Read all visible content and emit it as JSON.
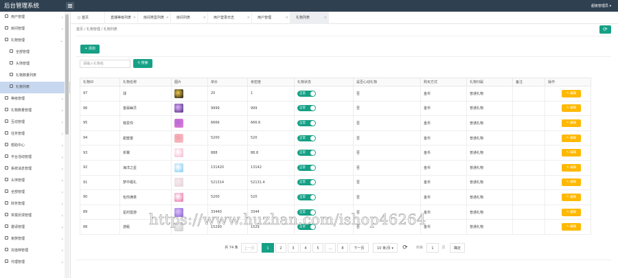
{
  "app": {
    "title": "后台管理系统",
    "user": "超级管理员"
  },
  "sidebar": {
    "items": [
      {
        "label": "用户管理",
        "sub": false,
        "active": false
      },
      {
        "label": "房间管理",
        "sub": false,
        "active": false
      },
      {
        "label": "礼物管理",
        "sub": false,
        "active": false,
        "expanded": true
      },
      {
        "label": "全部管理",
        "sub": true,
        "active": false
      },
      {
        "label": "头饰管理",
        "sub": true,
        "active": false
      },
      {
        "label": "礼物数量列表",
        "sub": true,
        "active": false
      },
      {
        "label": "礼物列表",
        "sub": true,
        "active": true
      },
      {
        "label": "等级管理",
        "sub": false,
        "active": false
      },
      {
        "label": "礼物数量管理",
        "sub": false,
        "active": false
      },
      {
        "label": "互动管理",
        "sub": false,
        "active": false
      },
      {
        "label": "任务管理",
        "sub": false,
        "active": false
      },
      {
        "label": "帮助中心",
        "sub": false,
        "active": false
      },
      {
        "label": "平台活动管理",
        "sub": false,
        "active": false
      },
      {
        "label": "系统消息管理",
        "sub": false,
        "active": false
      },
      {
        "label": "头饰管理",
        "sub": false,
        "active": false
      },
      {
        "label": "全部管理",
        "sub": false,
        "active": false
      },
      {
        "label": "财务管理",
        "sub": false,
        "active": false
      },
      {
        "label": "举报反馈管理",
        "sub": false,
        "active": false
      },
      {
        "label": "邀请管理",
        "sub": false,
        "active": false
      },
      {
        "label": "家族管理",
        "sub": false,
        "active": false
      },
      {
        "label": "充值档管理",
        "sub": false,
        "active": false
      },
      {
        "label": "代理管理",
        "sub": false,
        "active": false
      }
    ]
  },
  "tabs": [
    {
      "label": "首页",
      "active": false,
      "closable": false
    },
    {
      "label": "直播等级列表",
      "active": false,
      "closable": true
    },
    {
      "label": "房间类型列表",
      "active": false,
      "closable": true
    },
    {
      "label": "房间列表",
      "active": false,
      "closable": true
    },
    {
      "label": "用户登录日志",
      "active": false,
      "closable": true
    },
    {
      "label": "用户管理",
      "active": false,
      "closable": true
    },
    {
      "label": "礼物列表",
      "active": true,
      "closable": true
    }
  ],
  "breadcrumb": [
    "首页",
    "礼物管理",
    "礼物列表"
  ],
  "toolbar": {
    "add_label": "添加",
    "search_placeholder": "请输入礼物名",
    "search_label": "搜索"
  },
  "table": {
    "columns": [
      "礼物ID",
      "礼物名称",
      "图片",
      "单价",
      "亲密度",
      "礼物状态",
      "是否心动礼物",
      "购买方式",
      "礼物归属",
      "备注",
      "操作"
    ],
    "rows": [
      {
        "id": "97",
        "name": "球",
        "price": "20",
        "intimacy": "1",
        "status": "正常",
        "heartbeat": "否",
        "buy": "金币",
        "owner": "普通礼物",
        "note": "",
        "edit": "编辑",
        "img": [
          "#111",
          "#f2c94c"
        ]
      },
      {
        "id": "96",
        "name": "金属幽灵",
        "price": "9999",
        "intimacy": "999",
        "status": "正常",
        "heartbeat": "否",
        "buy": "金币",
        "owner": "普通礼物",
        "note": "",
        "edit": "编辑",
        "img": [
          "#4b2c7a",
          "#e0b0ff"
        ]
      },
      {
        "id": "95",
        "name": "我爱你",
        "price": "6666",
        "intimacy": "666.6",
        "status": "正常",
        "heartbeat": "否",
        "buy": "金币",
        "owner": "普通礼物",
        "note": "",
        "edit": "编辑",
        "img": [
          "#e87dd0",
          "#b06ad8"
        ]
      },
      {
        "id": "94",
        "name": "甜蜜蜜",
        "price": "5200",
        "intimacy": "520",
        "status": "正常",
        "heartbeat": "否",
        "buy": "金币",
        "owner": "普通礼物",
        "note": "",
        "edit": "编辑",
        "img": [
          "#f7c3c9",
          "#f2a0a8"
        ]
      },
      {
        "id": "93",
        "name": "折翼",
        "price": "888",
        "intimacy": "88.8",
        "status": "正常",
        "heartbeat": "否",
        "buy": "金币",
        "owner": "普通礼物",
        "note": "",
        "edit": "编辑",
        "img": [
          "#f5b5d0",
          "#ffffff"
        ]
      },
      {
        "id": "92",
        "name": "海洋之星",
        "price": "131420",
        "intimacy": "13142",
        "status": "正常",
        "heartbeat": "否",
        "buy": "金币",
        "owner": "普通礼物",
        "note": "",
        "edit": "编辑",
        "img": [
          "#7fc8f0",
          "#ffffff"
        ]
      },
      {
        "id": "91",
        "name": "梦中婚礼",
        "price": "521314",
        "intimacy": "52131.4",
        "status": "正常",
        "heartbeat": "否",
        "buy": "金币",
        "owner": "普通礼物",
        "note": "",
        "edit": "编辑",
        "img": [
          "#e8d0d8",
          "#f4ecef"
        ]
      },
      {
        "id": "90",
        "name": "包你满意",
        "price": "5200",
        "intimacy": "520",
        "status": "正常",
        "heartbeat": "否",
        "buy": "金币",
        "owner": "普通礼物",
        "note": "",
        "edit": "编辑",
        "img": [
          "#e86aa0",
          "#ffffff"
        ]
      },
      {
        "id": "89",
        "name": "星的盟游",
        "price": "33440",
        "intimacy": "3344",
        "status": "正常",
        "heartbeat": "否",
        "buy": "金币",
        "owner": "普通礼物",
        "note": "",
        "edit": "编辑",
        "img": [
          "#8a5ad8",
          "#d9c4f5"
        ]
      },
      {
        "id": "88",
        "name": "游艇",
        "price": "15290",
        "intimacy": "1529",
        "status": "正常",
        "heartbeat": "否",
        "buy": "金币",
        "owner": "普通礼物",
        "note": "",
        "edit": "编辑",
        "img": [
          "#cccccc",
          "#eeeeee"
        ]
      }
    ]
  },
  "pagination": {
    "total_label": "共 74 条",
    "prev": "上一页",
    "pages": [
      "1",
      "2",
      "3",
      "4",
      "5",
      "…",
      "8"
    ],
    "current": "1",
    "next": "下一页",
    "per_page": "10 条/页",
    "goto_label": "到第",
    "goto_value": "1",
    "page_unit": "页",
    "confirm": "确定"
  },
  "watermark": "https://www.huzhan.com/ishop46264",
  "colors": {
    "primary": "#16a085",
    "edit": "#ffb800",
    "topbar": "#2f4050",
    "active_menu": "#c7d7ef"
  }
}
